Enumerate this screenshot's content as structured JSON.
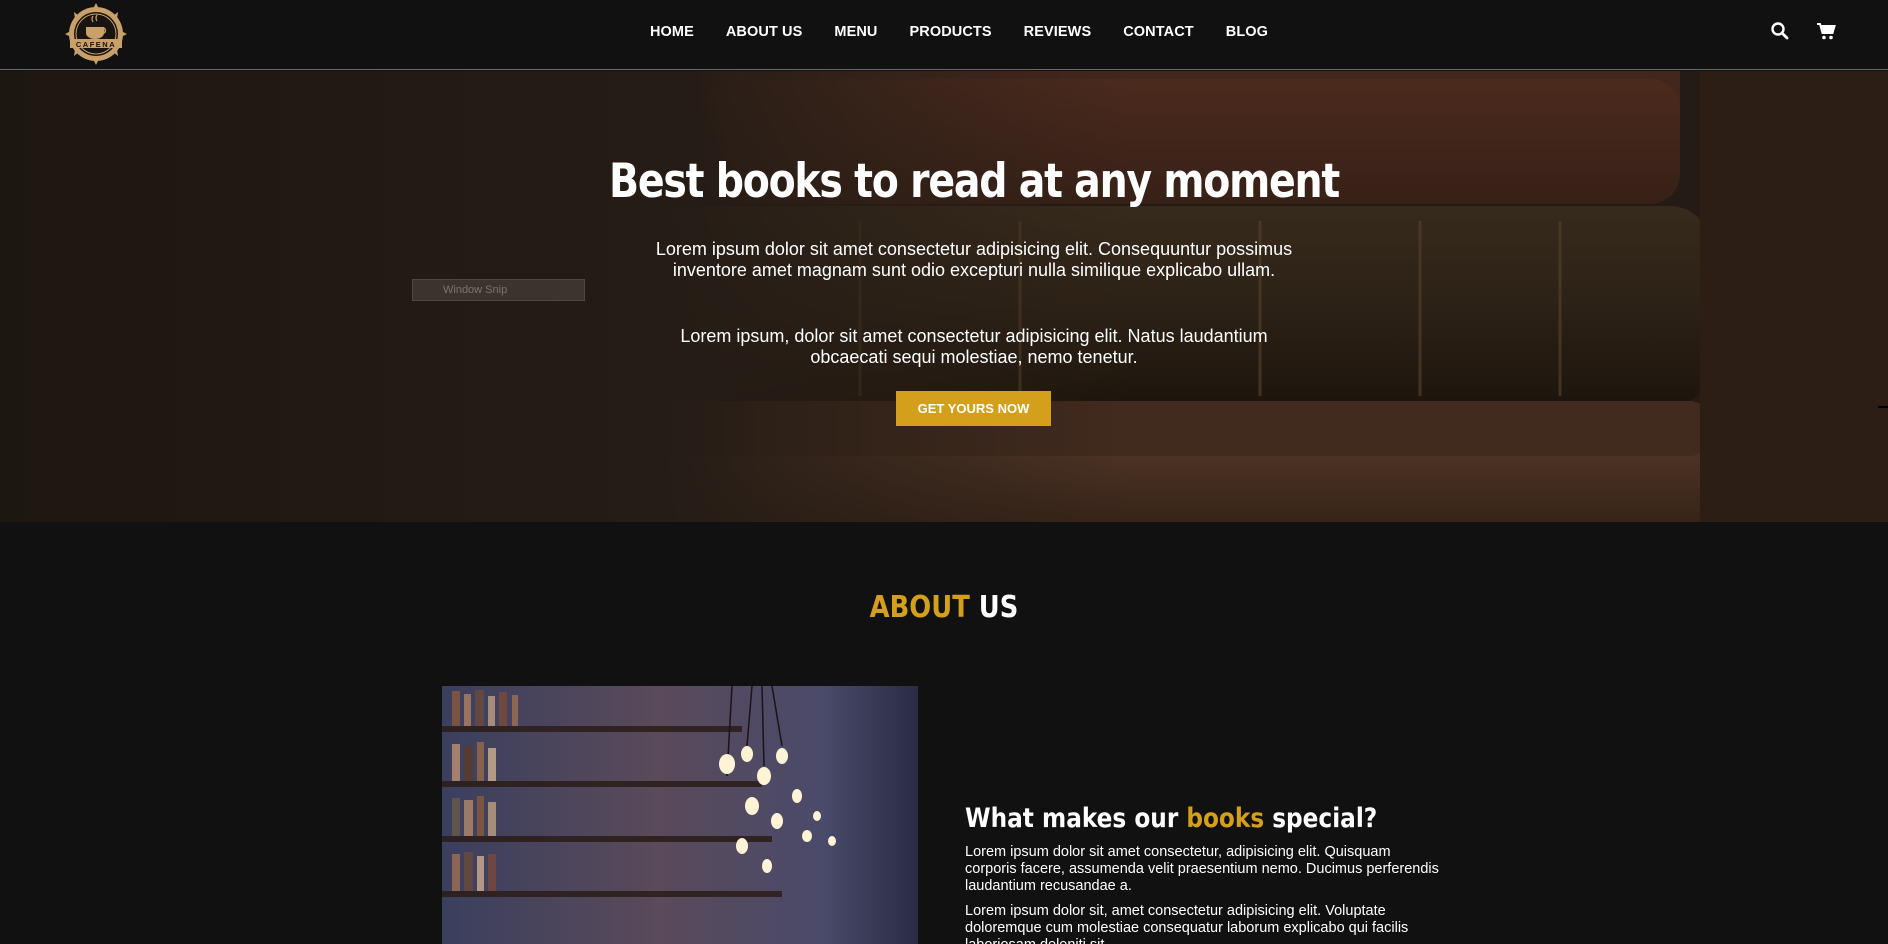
{
  "brand": {
    "logo_text": "CAFENA"
  },
  "nav": {
    "items": [
      {
        "label": "HOME"
      },
      {
        "label": "ABOUT US"
      },
      {
        "label": "MENU"
      },
      {
        "label": "PRODUCTS"
      },
      {
        "label": "REVIEWS"
      },
      {
        "label": "CONTACT"
      },
      {
        "label": "BLOG"
      }
    ]
  },
  "header_icons": {
    "search": "search-icon",
    "cart": "cart-icon"
  },
  "hero": {
    "snip_label": "Window Snip",
    "title": "Best books to read at any moment",
    "paragraph1": "Lorem ipsum dolor sit amet consectetur adipisicing elit. Consequuntur possimus inventore amet magnam sunt odio excepturi nulla similique explicabo ullam.",
    "paragraph2": "Lorem ipsum, dolor sit amet consectetur adipisicing elit. Natus laudantium obcaecati sequi molestiae, nemo tenetur.",
    "button_label": "GET YOURS NOW"
  },
  "about": {
    "title_accent": "ABOUT",
    "title_rest": "US",
    "heading_pre": "What makes our",
    "heading_accent": "books",
    "heading_post": "special?",
    "paragraph1": "Lorem ipsum dolor sit amet consectetur, adipisicing elit. Quisquam corporis facere, assumenda velit praesentium nemo. Ducimus perferendis laudantium recusandae a.",
    "paragraph2": "Lorem ipsum dolor sit, amet consectetur adipisicing elit. Voluptate doloremque cum molestiae consequatur laborum explicabo qui facilis laboriosam deleniti sit."
  },
  "colors": {
    "accent": "#d4a01c",
    "background": "#111111",
    "text": "#ffffff"
  }
}
